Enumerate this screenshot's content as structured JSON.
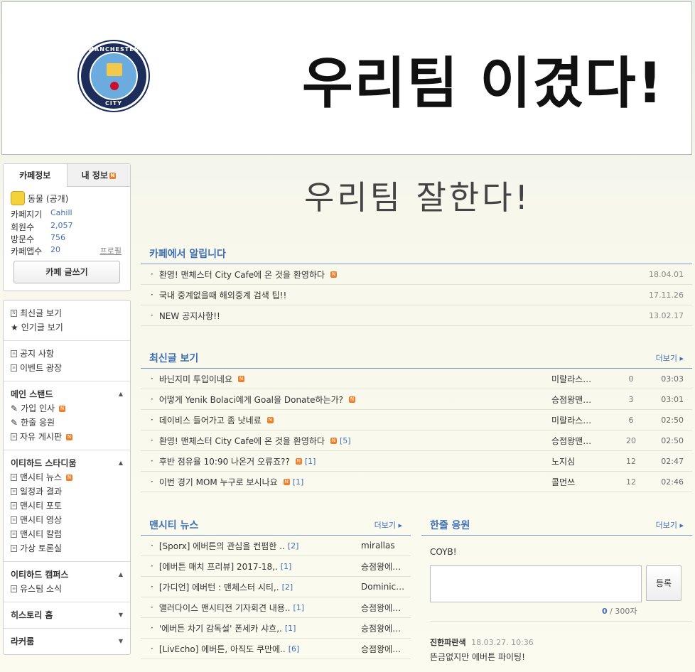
{
  "banner": {
    "title": "우리팀 이겼다!",
    "logo_top": "MANCHESTER",
    "logo_bottom": "CITY"
  },
  "sidebar": {
    "tabs": [
      "카페정보",
      "내 정보"
    ],
    "category": "동물 (공개)",
    "stats": [
      {
        "label": "카페지기",
        "value": "Cahill"
      },
      {
        "label": "회원수",
        "value": "2,057"
      },
      {
        "label": "방문수",
        "value": "756"
      },
      {
        "label": "카페앱수",
        "value": "20"
      }
    ],
    "profile": "프로필",
    "write": "카페 글쓰기",
    "menu1": [
      "최신글 보기",
      "인기글 보기"
    ],
    "menu2": [
      "공지 사항",
      "이벤트 광장"
    ],
    "sec_main": "메인 스탠드",
    "main_items": [
      "가입 인사",
      "한줄 응원",
      "자유 게시판"
    ],
    "sec_etihad": "이티하드 스타디움",
    "etihad_items": [
      "맨시티 뉴스",
      "일정과 결과",
      "맨시티 포토",
      "맨시티 영상",
      "맨시티 칼럼",
      "가상 토론실"
    ],
    "sec_campus": "이티하드 캠퍼스",
    "campus_items": [
      "유스팀 소식"
    ],
    "sec_history": "히스토리 홈",
    "sec_locker": "라커룸"
  },
  "main": {
    "cafe_title": "우리팀 잘한다!",
    "notice": {
      "title": "카페에서 알립니다",
      "rows": [
        {
          "text": "환영! 맨체스터 City Cafe에 온 것을 환영하다",
          "date": "18.04.01"
        },
        {
          "text": "국내 중계없을때 해외중계 검색 팁!!",
          "date": "17.11.26"
        },
        {
          "text": "NEW 공지사항!!",
          "date": "13.02.17"
        }
      ]
    },
    "latest": {
      "title": "최신글 보기",
      "more": "더보기 ▸",
      "rows": [
        {
          "text": "바닌지미 투입이네요",
          "comments": "",
          "author": "미랄라스…",
          "count": "0",
          "time": "03:03"
        },
        {
          "text": "어떻게 Yenik Bolaci에게 Goal을 Donate하는가?",
          "comments": "",
          "author": "승점왕맨…",
          "count": "3",
          "time": "03:01"
        },
        {
          "text": "데이비스 들어가고 좀 낫네료",
          "comments": "",
          "author": "미랄라스…",
          "count": "6",
          "time": "02:50"
        },
        {
          "text": "환영! 맨체스터 City Cafe에 온 것을 환영하다",
          "comments": "[5]",
          "author": "승점왕맨…",
          "count": "20",
          "time": "02:50"
        },
        {
          "text": "후반 점유율 10:90 나온거 오류죠??",
          "comments": "[1]",
          "author": "노지심",
          "count": "12",
          "time": "02:47"
        },
        {
          "text": "이번 경기 MOM 누구로 보시나요",
          "comments": "[1]",
          "author": "콜먼쓰",
          "count": "12",
          "time": "02:46"
        }
      ]
    },
    "news": {
      "title": "맨시티 뉴스",
      "more": "더보기 ▸",
      "rows": [
        {
          "text": "[Sporx] 에버튼의 관심을 컨펌한 ..",
          "comments": "[2]",
          "author": "mirallas"
        },
        {
          "text": "[에버튼 매치 프리뷰] 2017-18,.",
          "comments": "[1]",
          "author": "승점왕에…"
        },
        {
          "text": "[가디언] 에버턴 : 맨체스터 시티,.",
          "comments": "[2]",
          "author": "Dominic…"
        },
        {
          "text": "앨러다이스 맨시티전 기자회견 내용..",
          "comments": "[1]",
          "author": "승점왕에…"
        },
        {
          "text": "'에버튼 차기 감독설' 폰세카 샤흐,.",
          "comments": "[1]",
          "author": "승점왕에…"
        },
        {
          "text": "[LivEcho] 에버튼, 아직도 쿠만에..",
          "comments": "[6]",
          "author": "승점왕에…"
        }
      ]
    },
    "cheer": {
      "title": "한줄 응원",
      "more": "더보기 ▸",
      "text": "COYB!",
      "register": "등록",
      "count": "0",
      "max": "/ 300자",
      "comment_author": "진한파란색",
      "comment_date": "18.03.27. 10:36",
      "comment_text": "뜬금없지만 에버튼 파이팅!"
    }
  }
}
